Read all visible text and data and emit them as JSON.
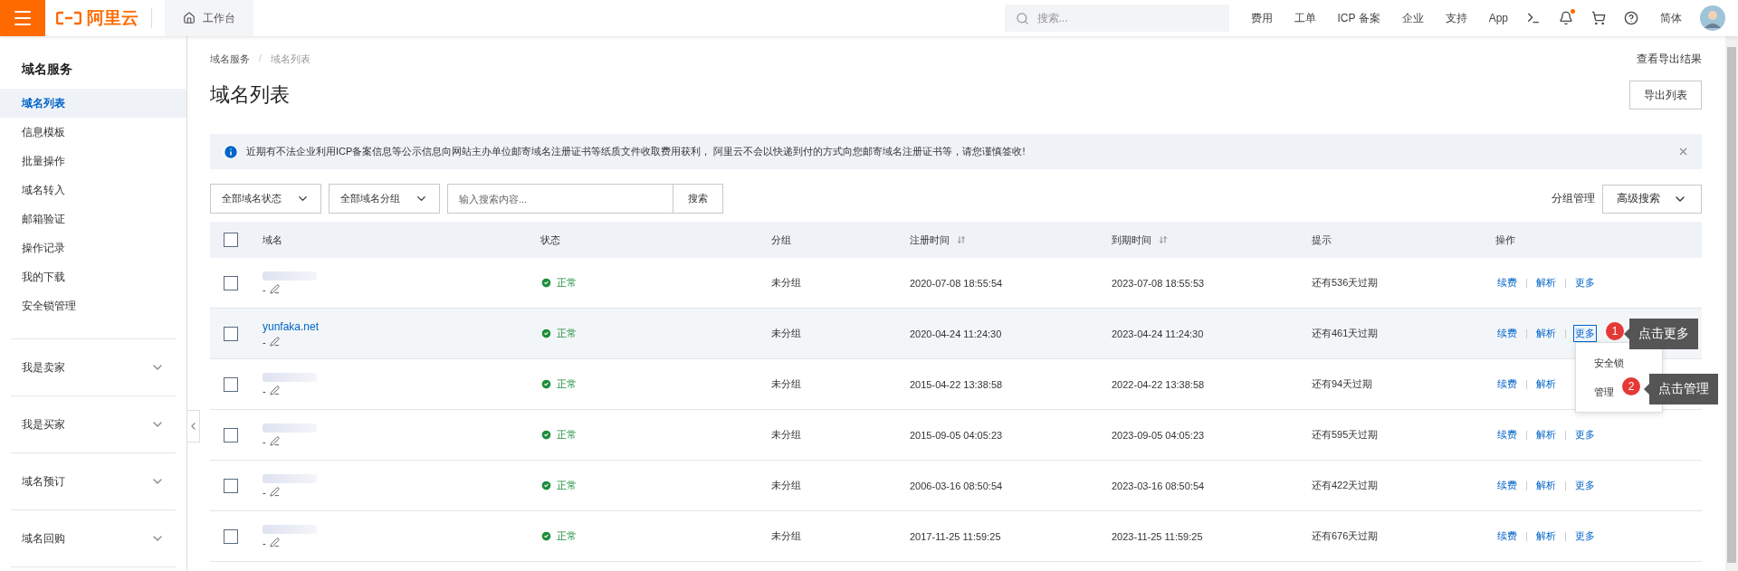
{
  "topbar": {
    "logo_text": "阿里云",
    "workbench": "工作台",
    "search_placeholder": "搜索...",
    "links": [
      "费用",
      "工单",
      "ICP 备案",
      "企业",
      "支持",
      "App"
    ],
    "notification_dot": true,
    "language": "简体"
  },
  "sidebar": {
    "title": "域名服务",
    "items": [
      {
        "label": "域名列表",
        "selected": true
      },
      {
        "label": "信息模板",
        "selected": false
      },
      {
        "label": "批量操作",
        "selected": false
      },
      {
        "label": "域名转入",
        "selected": false
      },
      {
        "label": "邮箱验证",
        "selected": false
      },
      {
        "label": "操作记录",
        "selected": false
      },
      {
        "label": "我的下载",
        "selected": false
      },
      {
        "label": "安全锁管理",
        "selected": false
      }
    ],
    "sections": [
      {
        "label": "我是卖家",
        "expanded": false
      },
      {
        "label": "我是买家",
        "expanded": false
      },
      {
        "label": "域名预订",
        "expanded": false
      },
      {
        "label": "域名回购",
        "expanded": false
      }
    ]
  },
  "breadcrumb": [
    "域名服务",
    "域名列表"
  ],
  "breadcrumb_separator": "/",
  "export_results_link": "查看导出结果",
  "title": "域名列表",
  "export_button": "导出列表",
  "alert": "近期有不法企业利用ICP备案信息等公示信息向网站主办单位邮寄域名注册证书等纸质文件收取费用获利， 阿里云不会以快递到付的方式向您邮寄域名注册证书等，请您谨慎签收!",
  "filters": {
    "status_select": "全部域名状态",
    "group_select": "全部域名分组",
    "search_placeholder": "输入搜索内容...",
    "search_button": "搜索",
    "group_manage": "分组管理",
    "advanced_search": "高级搜索"
  },
  "table": {
    "header_checked": false,
    "columns": [
      {
        "label": "域名",
        "sortable": false
      },
      {
        "label": "状态",
        "sortable": false
      },
      {
        "label": "分组",
        "sortable": false
      },
      {
        "label": "注册时间",
        "sortable": true
      },
      {
        "label": "到期时间",
        "sortable": true
      },
      {
        "label": "提示",
        "sortable": false
      },
      {
        "label": "操作",
        "sortable": false
      }
    ],
    "rows": [
      {
        "checked": false,
        "hovered": false,
        "remark": "-",
        "status": "正常",
        "group": "未分组",
        "registered": "2020-07-08 18:55:54",
        "expires": "2023-07-08 18:55:53",
        "hint": "还有536天过期",
        "actions": [
          {
            "label": "续费",
            "focused": false
          },
          {
            "label": "解析",
            "focused": false
          },
          {
            "label": "更多",
            "focused": false
          }
        ]
      },
      {
        "checked": false,
        "hovered": true,
        "domain": "yunfaka.net",
        "remark": "-",
        "status": "正常",
        "group": "未分组",
        "registered": "2020-04-24 11:24:30",
        "expires": "2023-04-24 11:24:30",
        "hint": "还有461天过期",
        "actions": [
          {
            "label": "续费",
            "focused": false
          },
          {
            "label": "解析",
            "focused": false
          },
          {
            "label": "更多",
            "focused": true
          }
        ]
      },
      {
        "checked": false,
        "hovered": false,
        "remark": "-",
        "status": "正常",
        "group": "未分组",
        "registered": "2015-04-22 13:38:58",
        "expires": "2022-04-22 13:38:58",
        "hint": "还有94天过期",
        "actions": [
          {
            "label": "续费",
            "focused": false
          },
          {
            "label": "解析",
            "focused": false
          }
        ]
      },
      {
        "checked": false,
        "hovered": false,
        "remark": "-",
        "status": "正常",
        "group": "未分组",
        "registered": "2015-09-05 04:05:23",
        "expires": "2023-09-05 04:05:23",
        "hint": "还有595天过期",
        "actions": [
          {
            "label": "续费",
            "focused": false
          },
          {
            "label": "解析",
            "focused": false
          },
          {
            "label": "更多",
            "focused": false
          }
        ]
      },
      {
        "checked": false,
        "hovered": false,
        "remark": "-",
        "status": "正常",
        "group": "未分组",
        "registered": "2006-03-16 08:50:54",
        "expires": "2023-03-16 08:50:54",
        "hint": "还有422天过期",
        "actions": [
          {
            "label": "续费",
            "focused": false
          },
          {
            "label": "解析",
            "focused": false
          },
          {
            "label": "更多",
            "focused": false
          }
        ]
      },
      {
        "checked": false,
        "hovered": false,
        "remark": "-",
        "status": "正常",
        "group": "未分组",
        "registered": "2017-11-25 11:59:25",
        "expires": "2023-11-25 11:59:25",
        "hint": "还有676天过期",
        "actions": [
          {
            "label": "续费",
            "focused": false
          },
          {
            "label": "解析",
            "focused": false
          },
          {
            "label": "更多",
            "focused": false
          }
        ]
      }
    ]
  },
  "dropdown": {
    "items": [
      "安全锁",
      "管理"
    ]
  },
  "annotations": [
    {
      "number": "1",
      "text": "点击更多"
    },
    {
      "number": "2",
      "text": "点击管理"
    }
  ]
}
